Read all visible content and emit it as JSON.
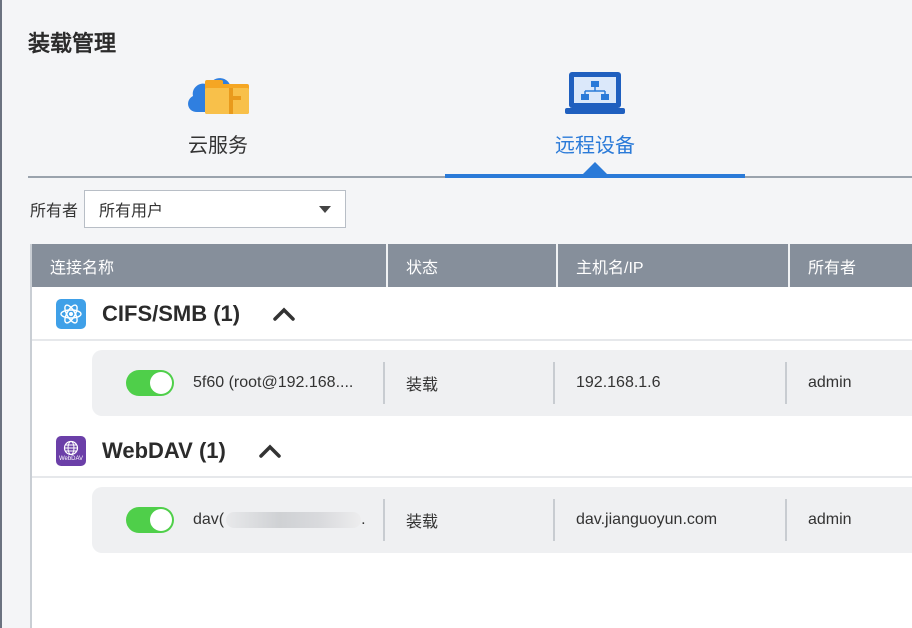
{
  "page": {
    "title": "装载管理"
  },
  "tabs": [
    {
      "label": "云服务",
      "icon": "cloud-folder-icon",
      "active": false
    },
    {
      "label": "远程设备",
      "icon": "remote-device-icon",
      "active": true
    }
  ],
  "filter": {
    "label": "所有者",
    "selected": "所有用户"
  },
  "table": {
    "columns": [
      "连接名称",
      "状态",
      "主机名/IP",
      "所有者"
    ]
  },
  "groups": [
    {
      "title": "CIFS/SMB (1)",
      "icon": "cifs-smb-icon",
      "rows": [
        {
          "name": "5f60 (root@192.168....",
          "status": "装载",
          "host": "192.168.1.6",
          "owner": "admin",
          "enabled": true
        }
      ]
    },
    {
      "title": "WebDAV (1)",
      "icon": "webdav-icon",
      "icon_text": "WebDAV",
      "rows": [
        {
          "name_prefix": "dav(",
          "name_suffix": ".",
          "status": "装载",
          "host": "dav.jianguoyun.com",
          "owner": "admin",
          "enabled": true
        }
      ]
    }
  ],
  "colors": {
    "accent": "#2a7ad8",
    "header_bg": "#868f9b",
    "toggle_on": "#4fcf4a",
    "webdav_purple": "#6b3fa8",
    "smb_blue": "#3fa0e8"
  }
}
